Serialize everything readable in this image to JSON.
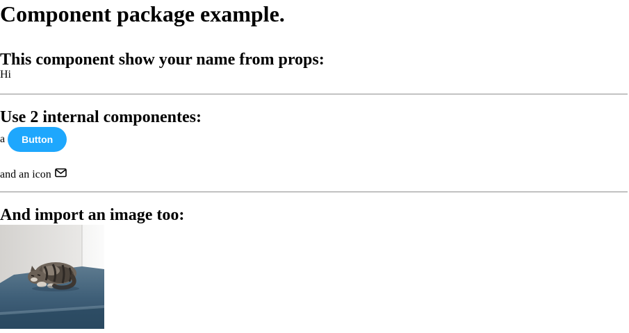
{
  "page": {
    "title": "Component package example.",
    "props_section": {
      "heading": "This component show your name from props:",
      "greeting": "Hi"
    },
    "internal_section": {
      "heading": "Use 2 internal componentes:",
      "prefix_text": "a",
      "button_label": "Button",
      "icon_text": "and an icon",
      "icon": "mail-icon"
    },
    "image_section": {
      "heading": "And import an image too:",
      "image_subject": "cat"
    }
  },
  "colors": {
    "button_bg": "#1ea7fd",
    "button_text": "#ffffff"
  }
}
